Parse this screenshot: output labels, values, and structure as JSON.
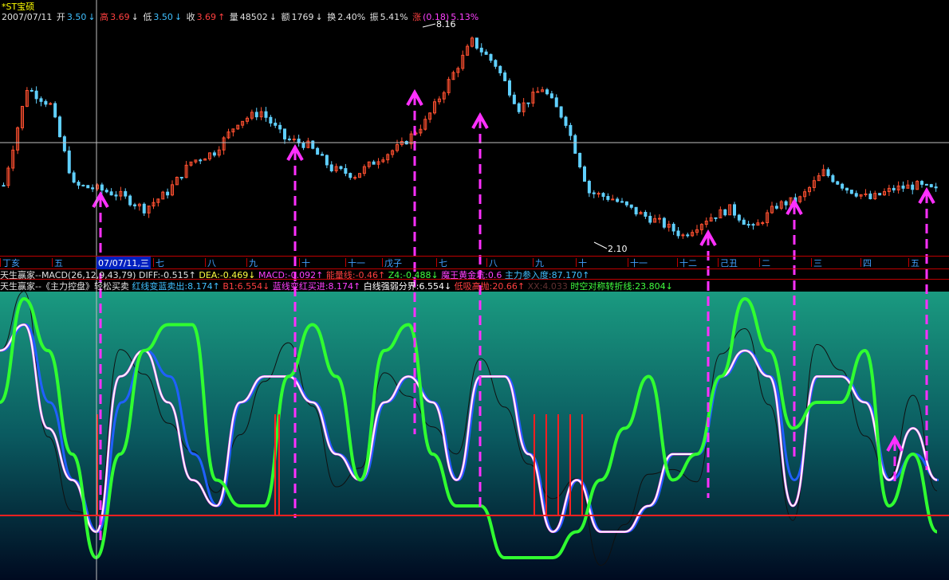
{
  "header": {
    "stock_name": "*ST宝硕",
    "date": "2007/07/11",
    "open_label": "开",
    "open": "3.50",
    "high_label": "高",
    "high": "3.69",
    "low_label": "低",
    "low": "3.50",
    "close_label": "收",
    "close": "3.69",
    "volume_label": "量",
    "volume": "48502",
    "amount_label": "额",
    "amount": "1769",
    "turnover_label": "换",
    "turnover": "2.40%",
    "amplitude_label": "振",
    "amplitude": "5.41%",
    "change_label": "涨",
    "change": "(0.18)",
    "change_pct": "5.13%"
  },
  "price_markers": {
    "high_marker": "8.16",
    "low_marker": "2.10"
  },
  "date_axis": {
    "selected_label": "07/07/11,三",
    "labels": [
      "丁亥",
      "五",
      "七",
      "八",
      "九",
      "十",
      "十一",
      "戊子",
      "七",
      "八",
      "九",
      "十",
      "十一",
      "十二",
      "己丑",
      "二",
      "三",
      "四",
      "五"
    ]
  },
  "indicator1": {
    "title": "天生赢家--MACD(26,12,9,43,79)",
    "diff": "DIFF:-0.515",
    "dea": "DEA:-0.469",
    "macd": "MACD:-0.092",
    "energy": "能量线:-0.46",
    "z4": "Z4:-0.488",
    "pit": "魔王黄金坑:0.6",
    "main_force": "主力参入度:87.170"
  },
  "indicator2": {
    "title": "天生赢家--《主力控盘》轻松买卖",
    "red_to_blue": "红线变蓝卖出:8.174",
    "b1": "B1:6.554",
    "blue_to_red": "蓝线变红买进:8.174",
    "white_line": "白线强弱分界:6.554",
    "low_buy": "低吸高抛:20.66",
    "xxx": "XX:4.033",
    "time_space": "时空对称转折线:23.804"
  },
  "colors": {
    "up_candle": "#ff5030",
    "down_candle": "#60d0ff",
    "arrow": "#ff30ff",
    "green_line": "#30ff30",
    "white_line": "#ffffff",
    "red_base": "#ff2020",
    "panel_top": "#1a9a80",
    "panel_bottom": "#001030"
  },
  "chart_data": [
    {
      "type": "candlestick",
      "title": "",
      "price_series": {
        "name": "",
        "x": [
          0,
          5,
          10,
          15,
          20,
          25,
          30,
          35,
          40,
          45,
          50,
          55,
          60,
          65,
          70,
          75,
          80,
          85,
          90,
          95,
          100,
          105,
          110,
          115,
          120,
          125,
          130,
          135,
          140,
          145,
          150,
          155,
          160,
          165,
          170,
          175,
          180,
          185,
          190,
          195,
          200
        ],
        "values": [
          3.6,
          6.5,
          6.0,
          3.6,
          3.5,
          3.3,
          2.9,
          3.4,
          4.3,
          4.6,
          5.5,
          5.8,
          5.0,
          4.8,
          4.1,
          3.9,
          4.4,
          4.8,
          5.5,
          6.7,
          7.9,
          7.2,
          5.9,
          6.5,
          5.5,
          3.4,
          3.2,
          2.8,
          2.5,
          2.1,
          2.6,
          2.9,
          2.3,
          3.0,
          3.2,
          4.0,
          3.5,
          3.2,
          3.5,
          3.6,
          3.4
        ]
      },
      "annotations": [
        "8.16",
        "2.10"
      ]
    },
    {
      "type": "line",
      "title": "",
      "series": [
        {
          "name": "",
          "values": [
            8,
            9,
            5,
            3,
            1,
            7,
            8,
            6,
            3,
            2,
            6,
            7,
            7,
            6,
            4,
            3,
            6,
            7,
            6,
            3,
            7,
            7,
            4,
            1,
            3,
            1,
            1,
            2,
            4,
            4,
            7,
            8,
            7,
            2,
            7,
            7,
            6,
            3,
            5,
            3
          ]
        },
        {
          "name": "",
          "values": [
            8,
            9,
            6,
            3,
            1,
            6,
            8,
            7,
            4,
            2,
            6,
            7,
            7,
            6,
            4,
            3,
            6,
            7,
            6,
            3,
            7,
            7,
            4,
            1,
            3,
            1,
            1,
            2,
            4,
            4,
            7,
            8,
            7,
            3,
            7,
            7,
            6,
            3,
            4,
            3
          ]
        },
        {
          "name": "",
          "values": [
            6,
            10,
            8,
            4,
            0,
            4,
            8,
            9,
            9,
            3,
            2,
            2,
            7,
            9,
            7,
            3,
            8,
            9,
            4,
            2,
            2,
            0,
            0,
            0,
            1,
            3,
            5,
            7,
            3,
            4,
            7,
            10,
            8,
            5,
            6,
            6,
            8,
            2,
            4,
            1
          ]
        }
      ]
    }
  ]
}
